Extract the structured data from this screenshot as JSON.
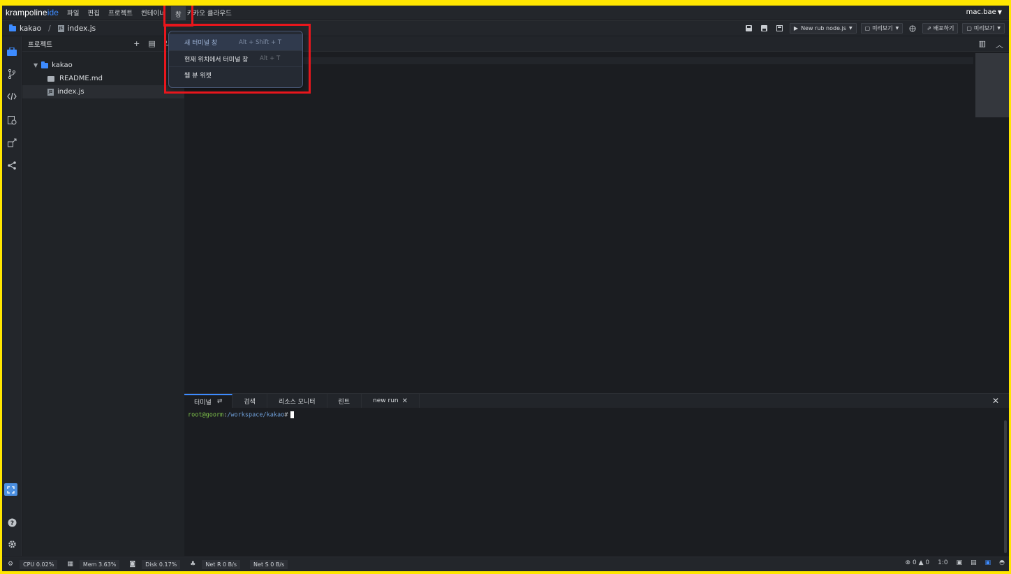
{
  "app": {
    "logo_main": "krampoline",
    "logo_suffix": "ide",
    "user_name": "mac.bae"
  },
  "menu": {
    "items": [
      "파일",
      "편집",
      "프로젝트",
      "컨테이너",
      "창",
      "카카오 클라우드"
    ]
  },
  "breadcrumb": {
    "project": "kakao",
    "separator": "/",
    "file": "index.js"
  },
  "toolbar": {
    "run_button": "New rub node.js",
    "preview_button": "미리보기",
    "deploy_button": "배포하기",
    "preview_button_2": "미리보기"
  },
  "sidebar": {
    "title": "프로젝트",
    "tree": [
      {
        "label": "kakao",
        "type": "folder"
      },
      {
        "label": "README.md",
        "type": "file"
      },
      {
        "label": "index.js",
        "type": "file"
      }
    ]
  },
  "window_menu": {
    "items": [
      {
        "label": "새 터미널 창",
        "shortcut": "Alt + Shift + T"
      },
      {
        "label": "현재 위치에서 터미널 창",
        "shortcut": "Alt + T"
      },
      {
        "label": "웹 뷰 위젯",
        "shortcut": ""
      }
    ]
  },
  "panel": {
    "tabs": [
      "터미널",
      "검색",
      "리소스 모니터",
      "린트",
      "new run"
    ],
    "prompt_user": "root@goorm",
    "prompt_sep": ":",
    "prompt_path": "/workspace/kakao",
    "prompt_char": "#"
  },
  "status": {
    "cpu": "CPU 0.02%",
    "mem": "Mem 3.63%",
    "disk": "Disk 0.17%",
    "net_r": "Net R 0 B/s",
    "net_s": "Net S 0 B/s",
    "errors": "0",
    "warnings": "0",
    "position": "1:0"
  },
  "colors": {
    "accent": "#3d8bff",
    "highlight_border": "#e8161c",
    "frame": "#ffe600"
  }
}
